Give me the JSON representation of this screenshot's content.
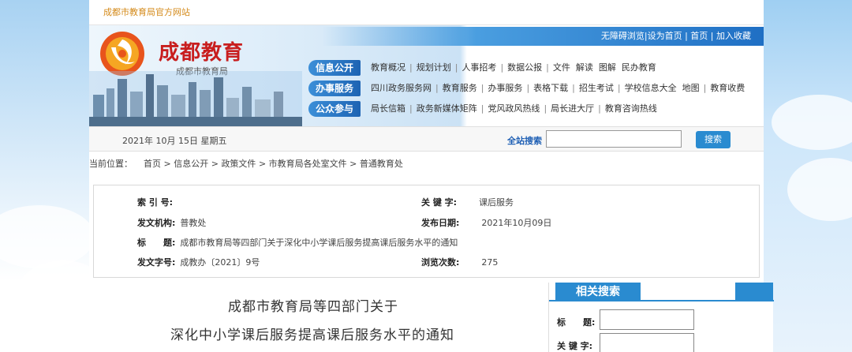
{
  "site": {
    "official_tag": "成都市教育局官方网站",
    "logo_title": "成都教育",
    "logo_subtitle": "成都市教育局"
  },
  "top_links": [
    "无障碍浏览",
    "设为首页",
    "首页",
    "加入收藏"
  ],
  "nav_labels": [
    "信息公开",
    "办事服务",
    "公众参与"
  ],
  "nav_rows": [
    [
      "教育概况",
      "规划计划",
      "人事招考",
      "数据公报",
      "文件",
      "解读",
      "图解",
      "民办教育"
    ],
    [
      "四川政务服务网",
      "教育服务",
      "办事服务",
      "表格下载",
      "招生考试",
      "学校信息大全",
      "地图",
      "教育收费"
    ],
    [
      "局长信箱",
      "政务新媒体矩阵",
      "党风政风热线",
      "局长进大厅",
      "教育咨询热线"
    ]
  ],
  "date_text": "2021年 10月 15日 星期五",
  "search": {
    "label": "全站搜索",
    "button": "搜索"
  },
  "breadcrumb": {
    "prefix": "当前位置：",
    "items": [
      "首页",
      "信息公开",
      "政策文件",
      "市教育局各处室文件",
      "普通教育处"
    ]
  },
  "meta": {
    "index_no_key": "索 引 号:",
    "index_no_val": "",
    "keywords_key": "关 键 字:",
    "keywords_val": "课后服务",
    "issuer_key": "发文机构:",
    "issuer_val": "普教处",
    "date_key": "发布日期:",
    "date_val": "2021年10月09日",
    "title_key": "标　　题:",
    "title_val": "成都市教育局等四部门关于深化中小学课后服务提高课后服务水平的通知",
    "docno_key": "发文字号:",
    "docno_val": "成教办〔2021〕9号",
    "views_key": "浏览次数:",
    "views_val": "275"
  },
  "document": {
    "title_line1": "成都市教育局等四部门关于",
    "title_line2": "深化中小学课后服务提高课后服务水平的通知"
  },
  "related_search": {
    "header": "相关搜索",
    "title_label": "标　　题:",
    "keyword_label": "关 键 字:"
  },
  "colors": {
    "brand_red": "#c81e1e",
    "nav_blue": "#1d63b3",
    "button_blue": "#2a8bd0",
    "tag_orange": "#d48a1a"
  }
}
